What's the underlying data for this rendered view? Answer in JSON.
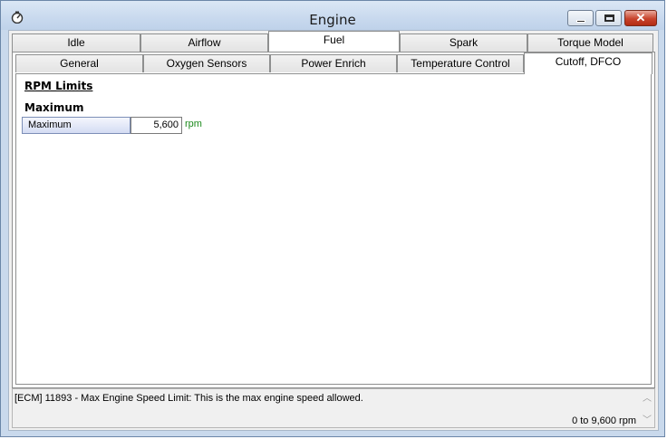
{
  "window": {
    "title": "Engine",
    "icon": "engine-gauge-icon",
    "close_glyph": "✕"
  },
  "main_tabs": [
    {
      "label": "Idle",
      "active": false
    },
    {
      "label": "Airflow",
      "active": false
    },
    {
      "label": "Fuel",
      "active": true
    },
    {
      "label": "Spark",
      "active": false
    },
    {
      "label": "Torque Model",
      "active": false
    }
  ],
  "sub_tabs": [
    {
      "label": "General",
      "active": false
    },
    {
      "label": "Oxygen Sensors",
      "active": false
    },
    {
      "label": "Power Enrich",
      "active": false
    },
    {
      "label": "Temperature Control",
      "active": false
    },
    {
      "label": "Cutoff, DFCO",
      "active": true
    }
  ],
  "content": {
    "section_title": "RPM Limits",
    "group_label": "Maximum",
    "parameter": {
      "name": "Maximum",
      "value": "5,600",
      "unit": "rpm"
    }
  },
  "status": {
    "description": "[ECM] 11893 - Max Engine Speed Limit: This is the max engine speed allowed.",
    "range": "0 to 9,600 rpm"
  },
  "colors": {
    "unit_text": "#1c8a1c",
    "title_bar": "#c8d9ee",
    "close_button": "#c8432c"
  }
}
